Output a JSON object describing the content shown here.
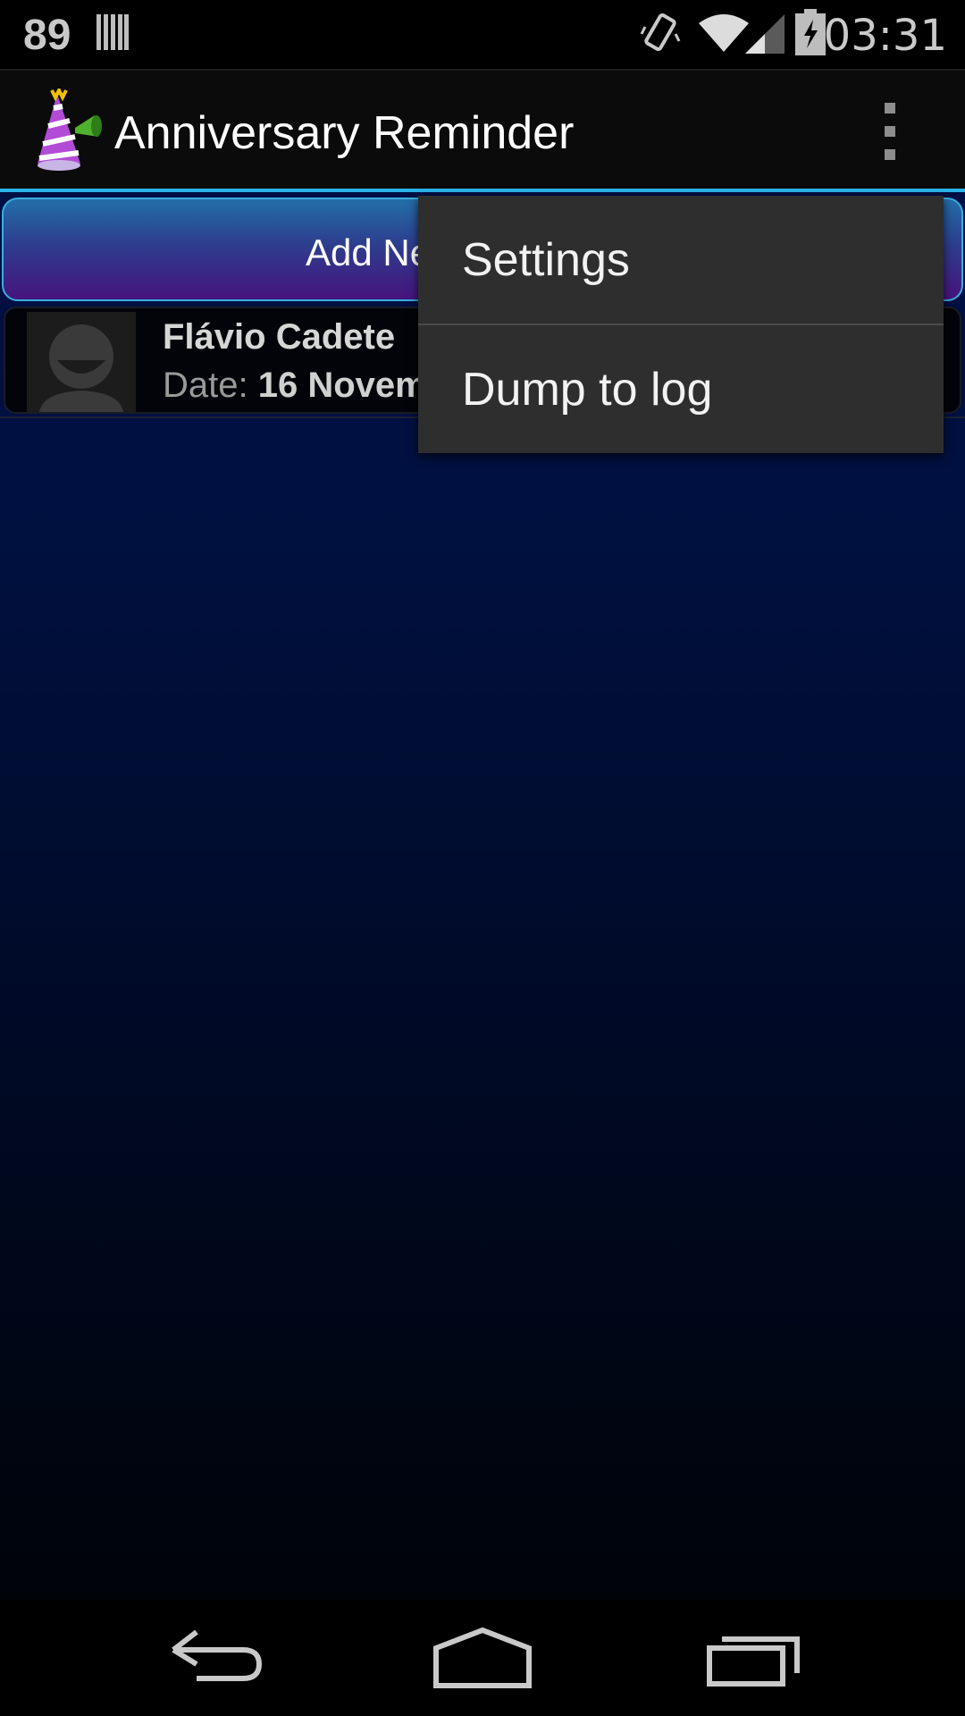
{
  "status_bar": {
    "left_text": "89",
    "time": "03:31",
    "icons": [
      "barcode-icon",
      "vibrate-icon",
      "wifi-icon",
      "signal-icon",
      "battery-charging-icon"
    ]
  },
  "action_bar": {
    "title": "Anniversary Reminder",
    "app_icon": "party-hat-icon",
    "overflow_icon": "overflow-menu-icon"
  },
  "content": {
    "add_button_label": "Add Ne",
    "items": [
      {
        "name": "Flávio Cadete",
        "date_label": "Date: ",
        "date_value": "16 Novem"
      }
    ]
  },
  "menu": {
    "items": [
      {
        "label": "Settings"
      },
      {
        "label": "Dump to log"
      }
    ]
  },
  "nav_bar": {
    "icons": [
      "back-icon",
      "home-icon",
      "recents-icon"
    ]
  },
  "colors": {
    "accent": "#2ab4e8",
    "button_top": "#236ea8",
    "button_bottom": "#47137e",
    "menu_bg": "#2e2e2e"
  }
}
